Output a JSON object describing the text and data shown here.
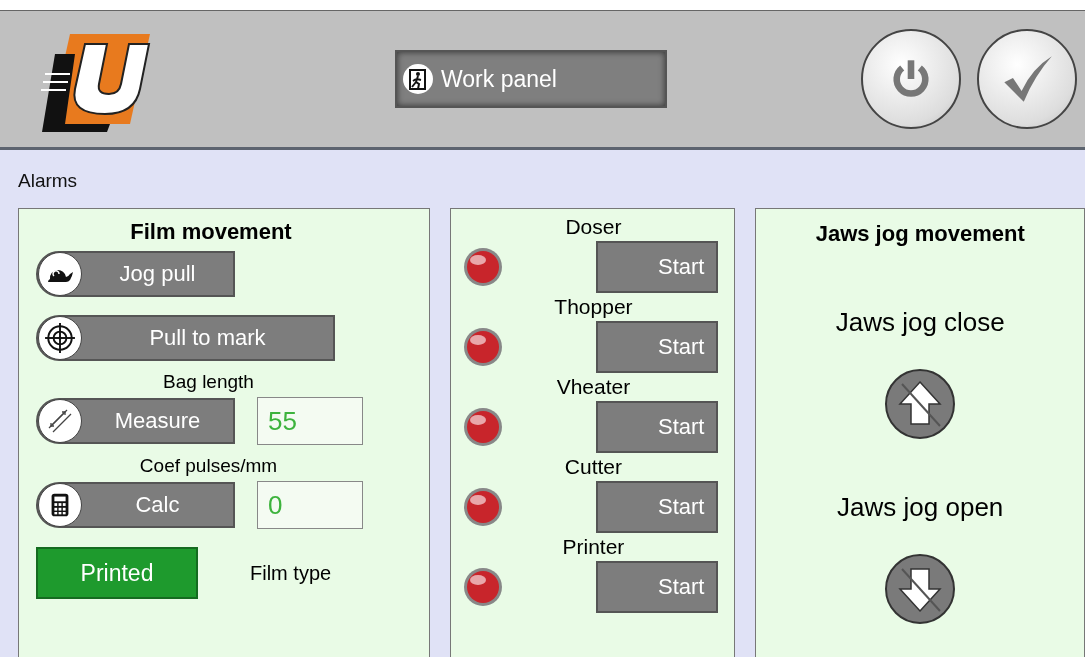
{
  "header": {
    "work_panel_button": "Work panel"
  },
  "alarms": "Alarms",
  "film_movement": {
    "title": "Film movement",
    "rows": [
      {
        "kind": "button",
        "label": "Jog pull"
      },
      {
        "kind": "button",
        "label": "Pull to mark"
      },
      {
        "kind": "field",
        "caption": "Bag length",
        "label": "Measure",
        "value": "55"
      },
      {
        "kind": "field",
        "caption": "Coef pulses/mm",
        "label": "Calc",
        "value": "0"
      }
    ],
    "film_type_button": {
      "label": "Printed",
      "active": true
    },
    "film_type_label": "Film type"
  },
  "devices": [
    {
      "name": "Doser",
      "on": false,
      "button": "Start"
    },
    {
      "name": "Thopper",
      "on": false,
      "button": "Start"
    },
    {
      "name": "Vheater",
      "on": false,
      "button": "Start"
    },
    {
      "name": "Cutter",
      "on": false,
      "button": "Start"
    },
    {
      "name": "Printer",
      "on": false,
      "button": "Start"
    }
  ],
  "jaws": {
    "title": "Jaws jog movement",
    "controls": [
      {
        "label": "Jaws jog close"
      },
      {
        "label": "Jaws jog open"
      }
    ]
  }
}
